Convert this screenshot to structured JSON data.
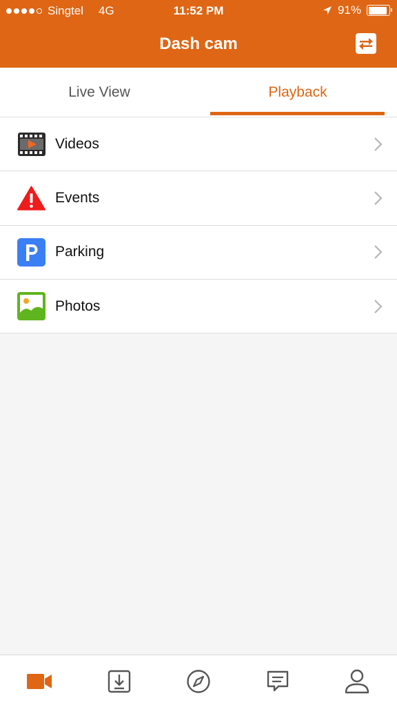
{
  "status_bar": {
    "carrier": "Singtel",
    "network": "4G",
    "time": "11:52 PM",
    "battery": "91%",
    "battery_level": 0.91,
    "signal_filled": 4,
    "signal_total": 5
  },
  "nav": {
    "title": "Dash cam",
    "switch_icon": "swap-icon"
  },
  "tabs": [
    {
      "label": "Live View",
      "active": false
    },
    {
      "label": "Playback",
      "active": true
    }
  ],
  "menu": [
    {
      "label": "Videos",
      "icon": "film-icon"
    },
    {
      "label": "Events",
      "icon": "warning-icon"
    },
    {
      "label": "Parking",
      "icon": "parking-icon"
    },
    {
      "label": "Photos",
      "icon": "photo-icon"
    }
  ],
  "tab_bar": [
    {
      "icon": "video-camera-icon",
      "active": true
    },
    {
      "icon": "download-icon",
      "active": false
    },
    {
      "icon": "compass-icon",
      "active": false
    },
    {
      "icon": "message-icon",
      "active": false
    },
    {
      "icon": "user-icon",
      "active": false
    }
  ],
  "colors": {
    "accent": "#de6614",
    "warning": "#ee1c1c",
    "parking": "#3b7ff5",
    "photo": "#5fb51e",
    "inactive_icon": "#555555"
  }
}
